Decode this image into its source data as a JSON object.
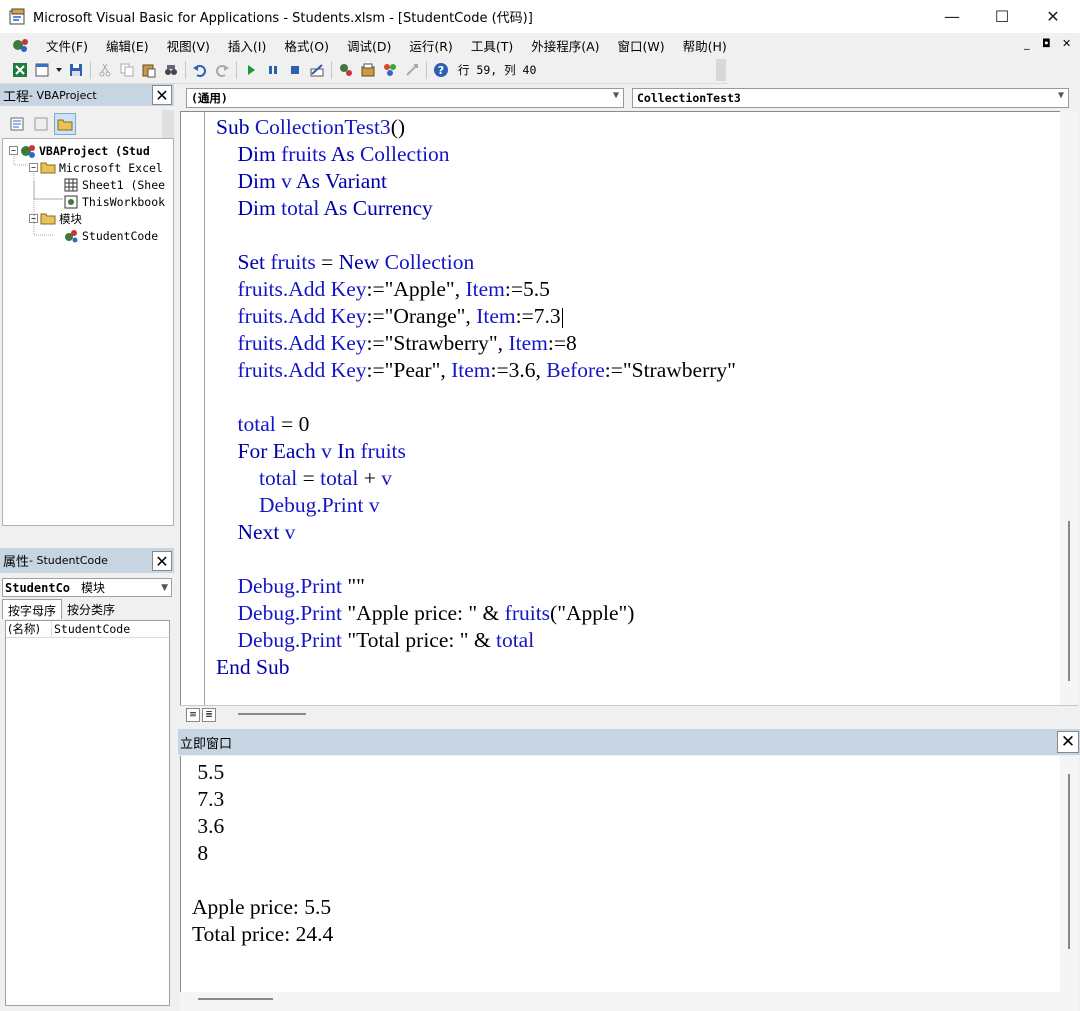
{
  "window": {
    "title": "Microsoft Visual Basic for Applications - Students.xlsm - [StudentCode (代码)]",
    "minimize": "—",
    "maximize": "☐",
    "close": "✕"
  },
  "menu": {
    "items": [
      "文件(F)",
      "编辑(E)",
      "视图(V)",
      "插入(I)",
      "格式(O)",
      "调试(D)",
      "运行(R)",
      "工具(T)",
      "外接程序(A)",
      "窗口(W)",
      "帮助(H)"
    ],
    "mdi_minimize": "_",
    "mdi_restore": "◘",
    "mdi_close": "✕"
  },
  "toolbar": {
    "position": "行 59, 列 40"
  },
  "project_pane": {
    "title": "工程",
    "subtitle": " - VBAProject",
    "close": "✕",
    "tree": [
      {
        "label": "VBAProject (Stud",
        "level": 0,
        "expander": "−",
        "icon": "project-icon",
        "bold": true
      },
      {
        "label": "Microsoft Excel",
        "level": 1,
        "expander": "−",
        "icon": "folder-icon",
        "bold": false
      },
      {
        "label": "Sheet1 (Shee",
        "level": 2,
        "expander": "",
        "icon": "sheet-icon",
        "bold": false
      },
      {
        "label": "ThisWorkbook",
        "level": 2,
        "expander": "",
        "icon": "workbook-icon",
        "bold": false
      },
      {
        "label": "模块",
        "level": 1,
        "expander": "−",
        "icon": "folder-icon",
        "bold": false
      },
      {
        "label": "StudentCode",
        "level": 2,
        "expander": "",
        "icon": "module-icon",
        "bold": false
      }
    ]
  },
  "properties_pane": {
    "title": "属性",
    "subtitle": " - StudentCode",
    "close": "✕",
    "object_name": "StudentCo",
    "object_type": "模块",
    "tabs": [
      "按字母序",
      "按分类序"
    ],
    "rows": [
      {
        "key": "(名称)",
        "value": "StudentCode"
      }
    ]
  },
  "code_window": {
    "object_combo": "(通用)",
    "procedure_combo": "CollectionTest3",
    "lines": [
      [
        {
          "t": "Sub ",
          "c": "kw"
        },
        {
          "t": "CollectionTest3",
          "c": "id"
        },
        {
          "t": "()",
          "c": "tx"
        }
      ],
      [
        {
          "t": "    Dim ",
          "c": "kw"
        },
        {
          "t": "fruits",
          "c": "id"
        },
        {
          "t": " As ",
          "c": "kw"
        },
        {
          "t": "Collection",
          "c": "id"
        }
      ],
      [
        {
          "t": "    Dim ",
          "c": "kw"
        },
        {
          "t": "v",
          "c": "id"
        },
        {
          "t": " As ",
          "c": "kw"
        },
        {
          "t": "Variant",
          "c": "kw"
        }
      ],
      [
        {
          "t": "    Dim ",
          "c": "kw"
        },
        {
          "t": "total",
          "c": "id"
        },
        {
          "t": " As ",
          "c": "kw"
        },
        {
          "t": "Currency",
          "c": "kw"
        }
      ],
      [],
      [
        {
          "t": "    Set ",
          "c": "kw"
        },
        {
          "t": "fruits",
          "c": "id"
        },
        {
          "t": " = ",
          "c": "tx"
        },
        {
          "t": "New ",
          "c": "kw"
        },
        {
          "t": "Collection",
          "c": "id"
        }
      ],
      [
        {
          "t": "    fruits.Add ",
          "c": "id"
        },
        {
          "t": "Key",
          "c": "id"
        },
        {
          "t": ":=\"Apple\", ",
          "c": "tx"
        },
        {
          "t": "Item",
          "c": "id"
        },
        {
          "t": ":=5.5",
          "c": "tx"
        }
      ],
      [
        {
          "t": "    fruits.Add ",
          "c": "id"
        },
        {
          "t": "Key",
          "c": "id"
        },
        {
          "t": ":=\"Orange\", ",
          "c": "tx"
        },
        {
          "t": "Item",
          "c": "id"
        },
        {
          "t": ":=7.3",
          "c": "tx"
        },
        {
          "t": "",
          "c": "caret"
        }
      ],
      [
        {
          "t": "    fruits.Add ",
          "c": "id"
        },
        {
          "t": "Key",
          "c": "id"
        },
        {
          "t": ":=\"Strawberry\", ",
          "c": "tx"
        },
        {
          "t": "Item",
          "c": "id"
        },
        {
          "t": ":=8",
          "c": "tx"
        }
      ],
      [
        {
          "t": "    fruits.Add ",
          "c": "id"
        },
        {
          "t": "Key",
          "c": "id"
        },
        {
          "t": ":=\"Pear\", ",
          "c": "tx"
        },
        {
          "t": "Item",
          "c": "id"
        },
        {
          "t": ":=3.6, ",
          "c": "tx"
        },
        {
          "t": "Before",
          "c": "id"
        },
        {
          "t": ":=\"Strawberry\"",
          "c": "tx"
        }
      ],
      [],
      [
        {
          "t": "    total",
          "c": "id"
        },
        {
          "t": " = 0",
          "c": "tx"
        }
      ],
      [
        {
          "t": "    For Each ",
          "c": "kw"
        },
        {
          "t": "v",
          "c": "id"
        },
        {
          "t": " In ",
          "c": "kw"
        },
        {
          "t": "fruits",
          "c": "id"
        }
      ],
      [
        {
          "t": "        total",
          "c": "id"
        },
        {
          "t": " = ",
          "c": "tx"
        },
        {
          "t": "total",
          "c": "id"
        },
        {
          "t": " + ",
          "c": "tx"
        },
        {
          "t": "v",
          "c": "id"
        }
      ],
      [
        {
          "t": "        Debug.Print ",
          "c": "id"
        },
        {
          "t": "v",
          "c": "id"
        }
      ],
      [
        {
          "t": "    Next ",
          "c": "kw"
        },
        {
          "t": "v",
          "c": "id"
        }
      ],
      [],
      [
        {
          "t": "    Debug.Print ",
          "c": "id"
        },
        {
          "t": "\"\"",
          "c": "tx"
        }
      ],
      [
        {
          "t": "    Debug.Print ",
          "c": "id"
        },
        {
          "t": "\"Apple price: \" & ",
          "c": "tx"
        },
        {
          "t": "fruits",
          "c": "id"
        },
        {
          "t": "(\"Apple\")",
          "c": "tx"
        }
      ],
      [
        {
          "t": "    Debug.Print ",
          "c": "id"
        },
        {
          "t": "\"Total price: \" & ",
          "c": "tx"
        },
        {
          "t": "total",
          "c": "id"
        }
      ],
      [
        {
          "t": "End Sub",
          "c": "kw"
        }
      ]
    ]
  },
  "immediate_window": {
    "title": "立即窗口",
    "close": "✕",
    "lines": [
      " 5.5",
      " 7.3",
      " 3.6",
      " 8",
      "",
      "Apple price: 5.5",
      "Total price: 24.4"
    ]
  },
  "colors": {
    "keyword": "#0000a8",
    "identifier": "#1515c8",
    "pane_header": "#c7d5e2"
  }
}
